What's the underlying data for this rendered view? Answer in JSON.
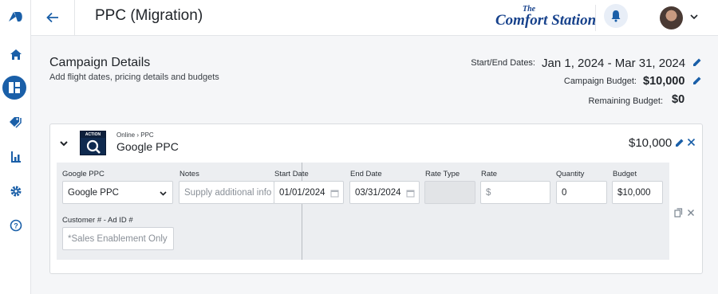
{
  "header": {
    "title": "PPC (Migration)",
    "brand_the": "The",
    "brand_name": "Comfort Station"
  },
  "sidebar": {
    "items": [
      {
        "icon": "logo-icon"
      },
      {
        "icon": "home-icon"
      },
      {
        "icon": "dashboard-icon",
        "active": true
      },
      {
        "icon": "tag-icon"
      },
      {
        "icon": "bar-chart-icon"
      },
      {
        "icon": "gear-icon"
      },
      {
        "icon": "help-icon"
      }
    ]
  },
  "campaign": {
    "title": "Campaign Details",
    "subtitle": "Add flight dates, pricing details and budgets",
    "dates_label": "Start/End Dates:",
    "dates_value": "Jan 1, 2024 - Mar 31, 2024",
    "budget_label": "Campaign Budget:",
    "budget_value": "$10,000",
    "remaining_label": "Remaining Budget:",
    "remaining_value": "$0"
  },
  "card": {
    "icon_tag": "ACTION",
    "breadcrumb": "Online › PPC",
    "title": "Google PPC",
    "budget": "$10,000",
    "fields": {
      "product_label": "Google PPC",
      "product_value": "Google PPC",
      "notes_label": "Notes",
      "notes_placeholder": "Supply additional info",
      "start_label": "Start Date",
      "start_value": "01/01/2024",
      "end_label": "End Date",
      "end_value": "03/31/2024",
      "rate_type_label": "Rate Type",
      "rate_label": "Rate",
      "rate_placeholder": "$",
      "quantity_label": "Quantity",
      "quantity_value": "0",
      "budget_label": "Budget",
      "budget_value": "$10,000",
      "customer_label": "Customer # - Ad ID #",
      "customer_placeholder": "*Sales Enablement Only"
    }
  },
  "colors": {
    "accent": "#1a5fa8",
    "brand": "#17428c"
  }
}
